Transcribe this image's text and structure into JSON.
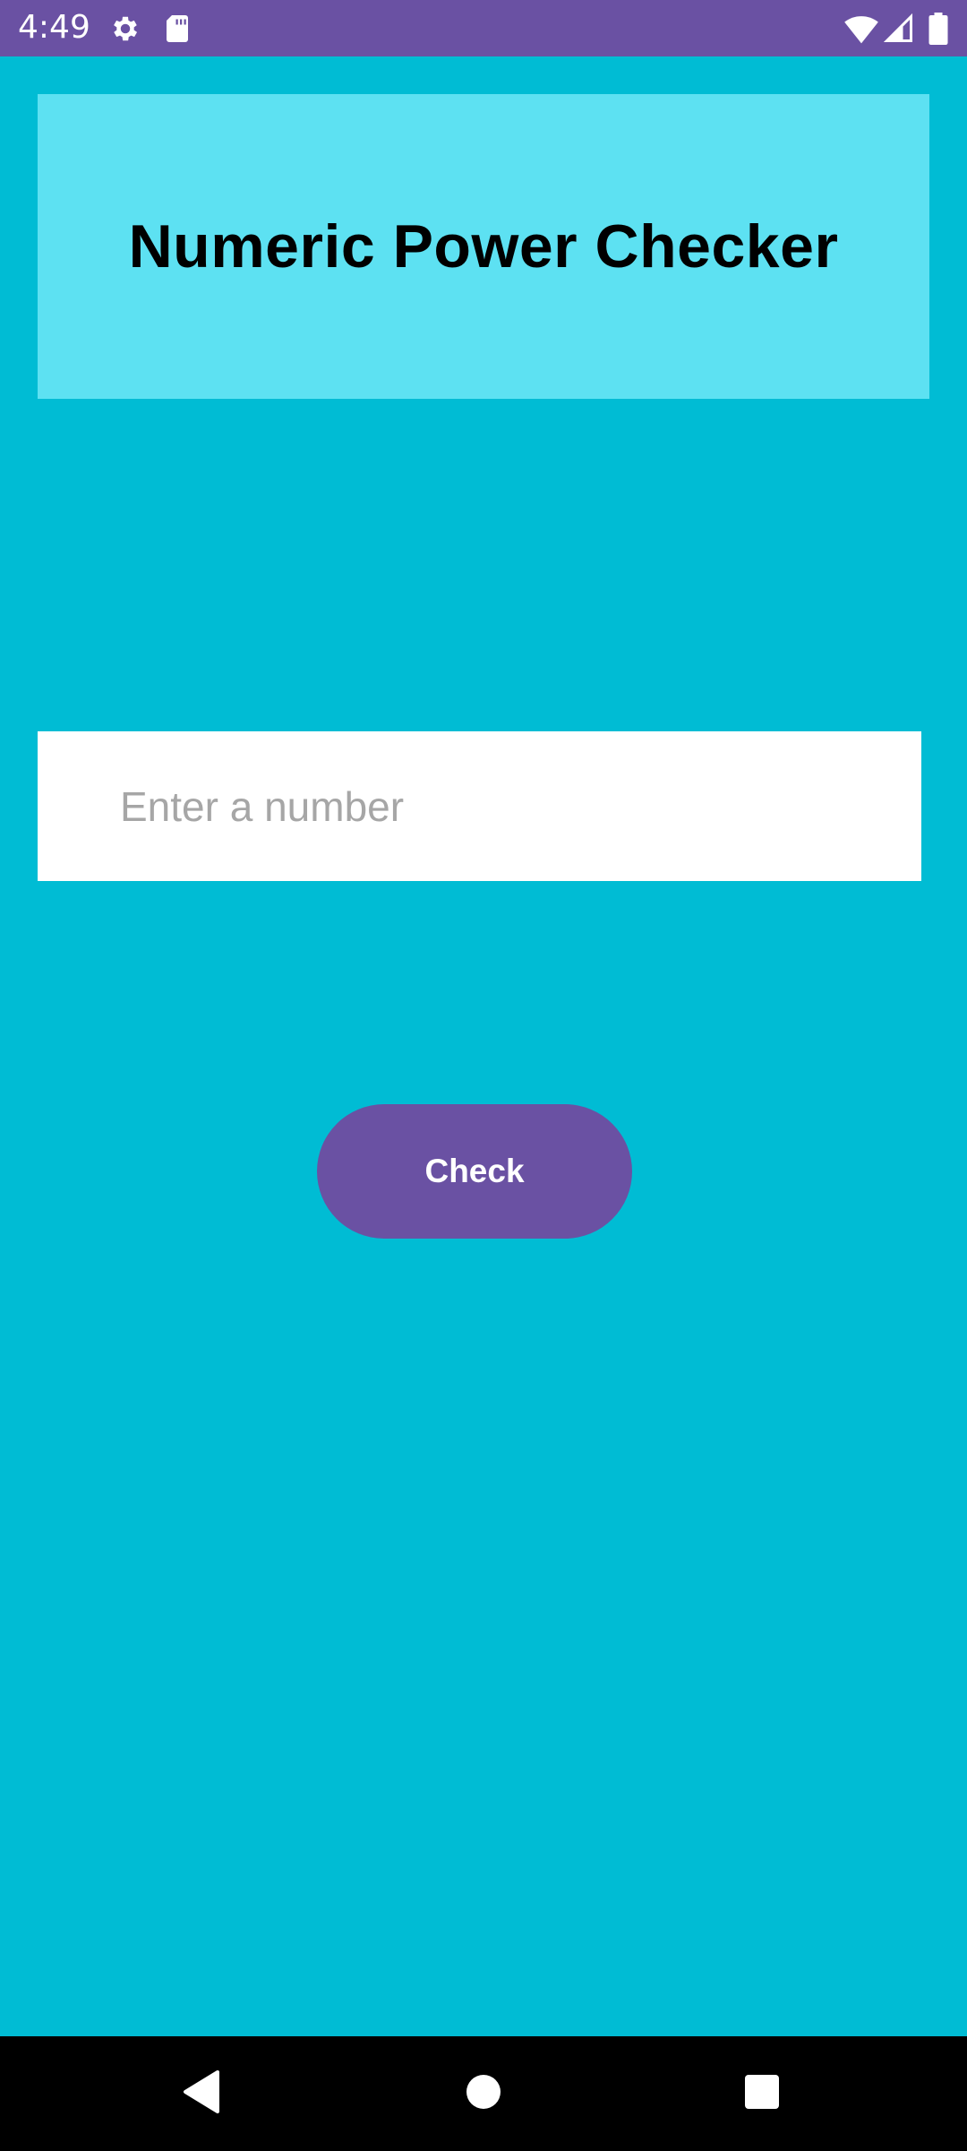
{
  "status_bar": {
    "time": "4:49",
    "left_icons": [
      "gear-icon",
      "sd-card-icon"
    ],
    "right_icons": [
      "wifi-icon",
      "cell-signal-icon",
      "battery-icon"
    ]
  },
  "header": {
    "title": "Numeric Power Checker"
  },
  "form": {
    "input_placeholder": "Enter a number",
    "input_value": "",
    "check_label": "Check"
  },
  "nav_bar": {
    "buttons": [
      "back-icon",
      "home-icon",
      "recents-icon"
    ]
  },
  "colors": {
    "background": "#00BCD4",
    "header_box": "#5DE1F2",
    "accent": "#6A51A3",
    "input_background": "#FFFFFF",
    "placeholder": "#A6A6A6",
    "nav_bar": "#000000"
  }
}
